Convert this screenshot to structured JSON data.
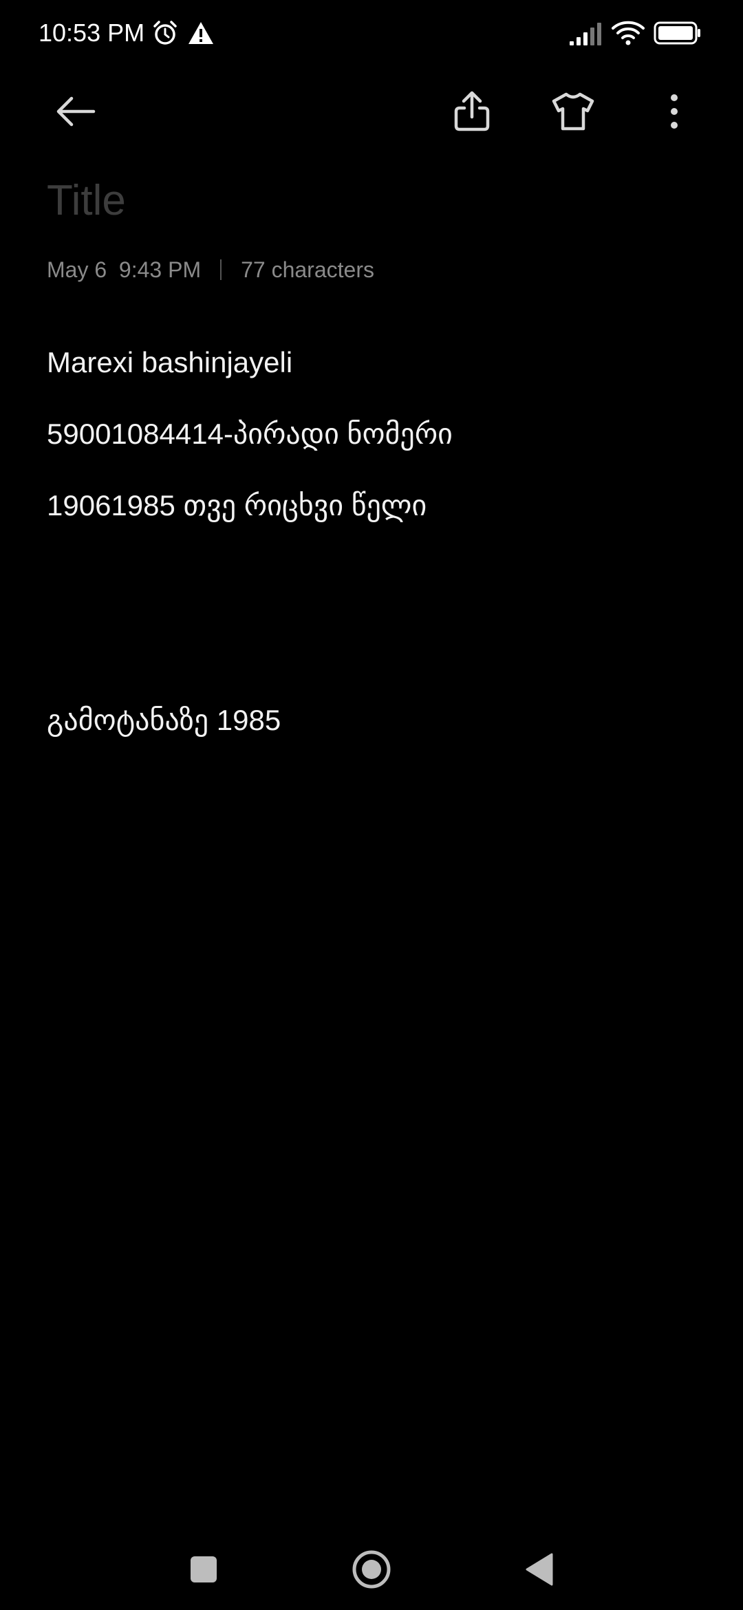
{
  "status_bar": {
    "time": "10:53 PM",
    "icons": [
      "alarm-icon",
      "warning-icon",
      "signal-icon",
      "wifi-icon",
      "battery-icon"
    ]
  },
  "toolbar": {
    "icons": [
      "back-arrow-icon",
      "share-icon",
      "shirt-icon",
      "more-vert-icon"
    ]
  },
  "note": {
    "title_placeholder": "Title",
    "date": "May 6  9:43 PM",
    "char_count": "77 characters",
    "lines": [
      "Marexi bashinjayeli",
      "59001084414-პირადი ნომერი",
      "19061985 თვე რიცხვი წელი",
      "გამოტანაზე 1985"
    ]
  },
  "nav_bar": {
    "icons": [
      "recents-icon",
      "home-icon",
      "back-triangle-icon"
    ]
  },
  "colors": {
    "background": "#000000",
    "text": "#f2f2f2",
    "meta": "#8a8a8a",
    "placeholder": "#3d3d3d"
  }
}
